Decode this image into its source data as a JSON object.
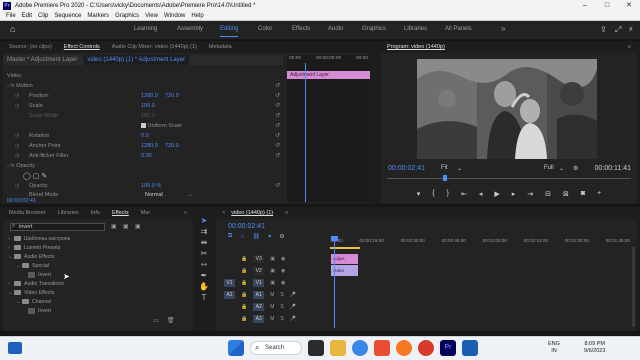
{
  "window": {
    "title": "Adobe Premiere Pro 2020 - C:\\Users\\vicky\\Documents\\Adobe\\Premiere Pro\\14.0\\Untitled *",
    "app_icon": "Pr"
  },
  "menu": [
    "File",
    "Edit",
    "Clip",
    "Sequence",
    "Markers",
    "Graphics",
    "View",
    "Window",
    "Help"
  ],
  "workspaces": {
    "items": [
      "Learning",
      "Assembly",
      "Editing",
      "Color",
      "Effects",
      "Audio",
      "Graphics",
      "Libraries",
      "All Panels"
    ],
    "active": "Editing",
    "more": "»"
  },
  "effect_controls": {
    "tabs": [
      "Source: (no clips)",
      "Effect Controls",
      "Audio Clip Mixer: video (1440p) (1)",
      "Metadata"
    ],
    "active_tab": "Effect Controls",
    "master": "Master * Adjustment Layer",
    "sequence": "video (1440p) (1) * Adjustment Layer",
    "section_video": "Video",
    "motion": "Motion",
    "position_label": "Position",
    "position_x": "1280.0",
    "position_y": "720.0",
    "scale_label": "Scale",
    "scale_value": "100.0",
    "scale_width_label": "Scale Width",
    "uniform_scale": "Uniform Scale",
    "rotation_label": "Rotation",
    "rotation_value": "0.0",
    "anchor_label": "Anchor Point",
    "anchor_x": "1280.0",
    "anchor_y": "720.0",
    "antiflicker_label": "Anti-flicker Filter",
    "antiflicker_value": "0.00",
    "opacity": "Opacity",
    "opacity_label": "Opacity",
    "opacity_value": "100.0 %",
    "blend_label": "Blend Mode",
    "blend_value": "Normal",
    "timeline_ruler": [
      "00:00",
      "00:00:05:00",
      "00:00"
    ],
    "adjustment_clip": "Adjustment Layer",
    "timecode": "00:00:02:41"
  },
  "program_monitor": {
    "title": "Program: video (1440p)",
    "timecode_current": "00:00:02:41",
    "timecode_duration": "00:00:11:41",
    "fit": "Fit",
    "quality": "Full",
    "controls": [
      "marker",
      "in",
      "out",
      "step-back",
      "step-back-frame",
      "play",
      "step-forward-frame",
      "step-forward",
      "lift",
      "extract",
      "export-frame",
      "plus"
    ]
  },
  "project": {
    "tabs": [
      "Media Browser",
      "Libraries",
      "Info",
      "Effects",
      "Mar"
    ],
    "active_tab": "Effects",
    "search_value": "invert",
    "tree": [
      {
        "label": "Шаблоны настроек",
        "kind": "folder",
        "indent": 0
      },
      {
        "label": "Lumetri Presets",
        "kind": "folder",
        "indent": 0
      },
      {
        "label": "Audio Effects",
        "kind": "folder",
        "indent": 0
      },
      {
        "label": "Special",
        "kind": "folder",
        "indent": 1
      },
      {
        "label": "Invert",
        "kind": "fx",
        "indent": 2
      },
      {
        "label": "Audio Transitions",
        "kind": "folder",
        "indent": 0
      },
      {
        "label": "Video Effects",
        "kind": "folder",
        "indent": 0
      },
      {
        "label": "Channel",
        "kind": "folder",
        "indent": 1
      },
      {
        "label": "Invert",
        "kind": "fx",
        "indent": 2
      }
    ]
  },
  "timeline": {
    "title": "video (1440p) (1)",
    "timecode": "00:00:02:41",
    "ruler": [
      ":00:00",
      "00:00:15:00",
      "00:00:30:00",
      "00:00:45:00",
      "00:01:00:00",
      "00:01:15:00",
      "00:01:30:00",
      "00:01:45:00"
    ],
    "tracks": [
      "V3",
      "V2",
      "V1",
      "A1",
      "A2",
      "A3"
    ],
    "source_v": "V1",
    "source_a": "A1",
    "clip_adj": "Adjus",
    "clip_video": "video"
  },
  "tools": [
    "selection",
    "track-select",
    "ripple",
    "razor",
    "slip",
    "pen",
    "hand",
    "type"
  ],
  "taskbar": {
    "search": "Search",
    "lang_1": "ENG",
    "lang_2": "IN",
    "time": "8:09 PM",
    "date": "9/6/2023"
  },
  "colors": {
    "accent": "#4d8df7",
    "adjustment_layer": "#d68cd5",
    "video_clip": "#b5a3e6",
    "panel_bg": "#232323"
  }
}
